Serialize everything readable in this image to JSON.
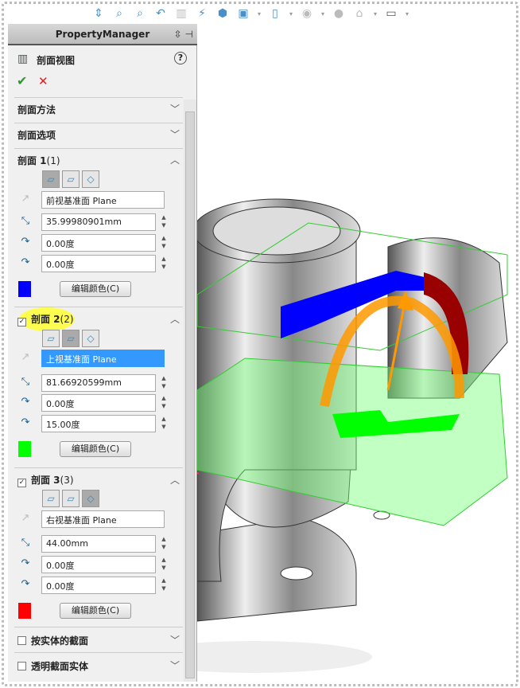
{
  "toolbar": {
    "icons": [
      "view-orientation-icon",
      "zoom-fit-icon",
      "zoom-area-icon",
      "previous-view-icon",
      "section-view-icon",
      "dynamic-annotation-icon",
      "view-cube-icon",
      "display-style-icon",
      "hide-show-icon",
      "edit-appearance-icon",
      "apply-scene-icon",
      "view-settings-icon"
    ]
  },
  "panel": {
    "title": "PropertyManager",
    "feature_title": "剖面视图",
    "help": "?",
    "ok": "✔",
    "cancel": "✕"
  },
  "sections": {
    "method": "剖面方法",
    "options": "剖面选项"
  },
  "section1": {
    "label": "剖面 1",
    "suffix": "(1)",
    "plane": "前视基准面 Plane",
    "distance": "35.99980901mm",
    "rot_x": "0.00度",
    "rot_y": "0.00度",
    "color": "#0000ff",
    "edit_color": "编辑颜色(C)"
  },
  "section2": {
    "label": "剖面 2",
    "suffix": "(2)",
    "checked": true,
    "plane": "上视基准面 Plane",
    "distance": "81.66920599mm",
    "rot_x": "0.00度",
    "rot_y": "15.00度",
    "color": "#00ff00",
    "edit_color": "编辑颜色(C)"
  },
  "section3": {
    "label": "剖面 3",
    "suffix": "(3)",
    "checked": true,
    "plane": "右视基准面 Plane",
    "distance": "44.00mm",
    "rot_x": "0.00度",
    "rot_y": "0.00度",
    "color": "#ff0000",
    "edit_color": "编辑颜色(C)"
  },
  "bottom": {
    "by_body": "按实体的截面",
    "transparent": "透明截面实体"
  }
}
